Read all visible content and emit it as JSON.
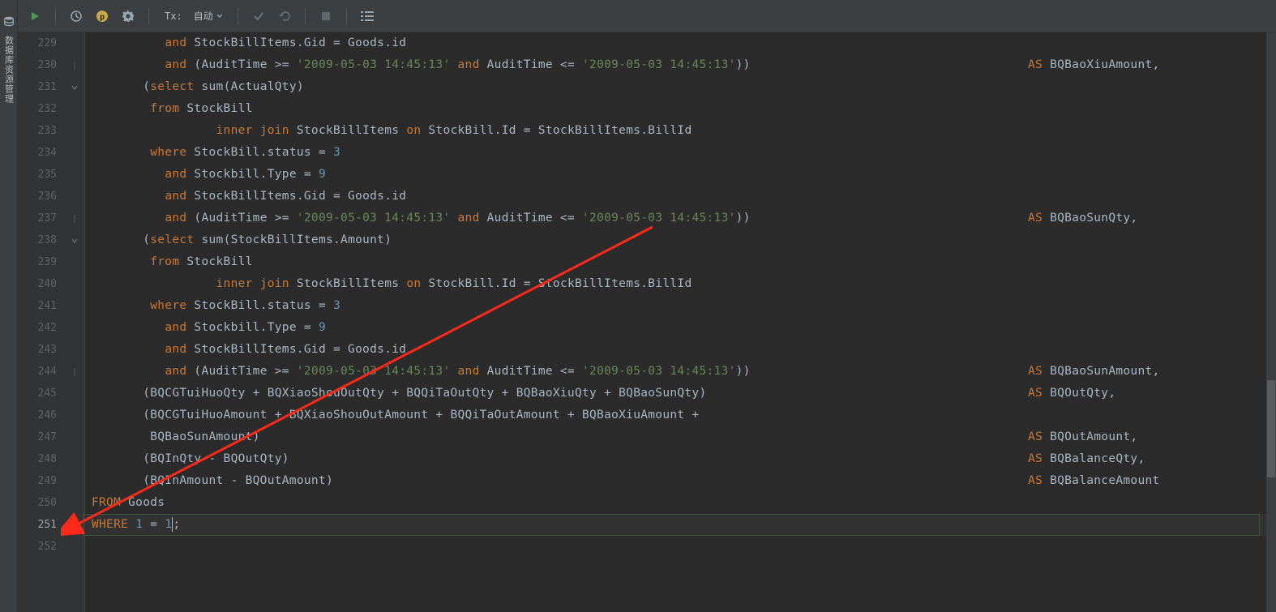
{
  "sidebar": {
    "label": "数据库资源管理"
  },
  "toolbar": {
    "tx_label": "Tx:",
    "tx_value": "自动"
  },
  "gutter": {
    "start": 229,
    "end": 252
  },
  "code": {
    "lines": [
      {
        "n": 229,
        "seg": [
          {
            "t": "          ",
            "c": ""
          },
          {
            "t": "and",
            "c": "kw"
          },
          {
            "t": " StockBillItems.Gid = Goods.id",
            "c": "id"
          }
        ]
      },
      {
        "n": 230,
        "fold": "mid",
        "seg": [
          {
            "t": "          ",
            "c": ""
          },
          {
            "t": "and",
            "c": "kw"
          },
          {
            "t": " (AuditTime >= ",
            "c": "id"
          },
          {
            "t": "'2009-05-03 14:45:13'",
            "c": "str"
          },
          {
            "t": " ",
            "c": ""
          },
          {
            "t": "and",
            "c": "kw"
          },
          {
            "t": " AuditTime <= ",
            "c": "id"
          },
          {
            "t": "'2009-05-03 14:45:13'",
            "c": "str"
          },
          {
            "t": "))",
            "c": "paren"
          }
        ],
        "right": [
          {
            "t": "AS",
            "c": "kw"
          },
          {
            "t": " BQBaoXiuAmount,",
            "c": "id"
          }
        ]
      },
      {
        "n": 231,
        "fold": "open",
        "seg": [
          {
            "t": "       (",
            "c": "paren"
          },
          {
            "t": "select",
            "c": "kw"
          },
          {
            "t": " ",
            "c": ""
          },
          {
            "t": "sum",
            "c": "fn"
          },
          {
            "t": "(ActualQty)",
            "c": "id"
          }
        ]
      },
      {
        "n": 232,
        "seg": [
          {
            "t": "        ",
            "c": ""
          },
          {
            "t": "from",
            "c": "kw"
          },
          {
            "t": " StockBill",
            "c": "id"
          }
        ]
      },
      {
        "n": 233,
        "seg": [
          {
            "t": "                 ",
            "c": ""
          },
          {
            "t": "inner join",
            "c": "kw"
          },
          {
            "t": " StockBillItems ",
            "c": "id"
          },
          {
            "t": "on",
            "c": "kw"
          },
          {
            "t": " StockBill.Id = StockBillItems.BillId",
            "c": "id"
          }
        ]
      },
      {
        "n": 234,
        "seg": [
          {
            "t": "        ",
            "c": ""
          },
          {
            "t": "where",
            "c": "kw"
          },
          {
            "t": " StockBill.status = ",
            "c": "id"
          },
          {
            "t": "3",
            "c": "num"
          }
        ]
      },
      {
        "n": 235,
        "seg": [
          {
            "t": "          ",
            "c": ""
          },
          {
            "t": "and",
            "c": "kw"
          },
          {
            "t": " Stockbill.Type = ",
            "c": "id"
          },
          {
            "t": "9",
            "c": "num"
          }
        ]
      },
      {
        "n": 236,
        "seg": [
          {
            "t": "          ",
            "c": ""
          },
          {
            "t": "and",
            "c": "kw"
          },
          {
            "t": " StockBillItems.Gid = Goods.id",
            "c": "id"
          }
        ]
      },
      {
        "n": 237,
        "fold": "mid",
        "seg": [
          {
            "t": "          ",
            "c": ""
          },
          {
            "t": "and",
            "c": "kw"
          },
          {
            "t": " (AuditTime >= ",
            "c": "id"
          },
          {
            "t": "'2009-05-03 14:45:13'",
            "c": "str"
          },
          {
            "t": " ",
            "c": ""
          },
          {
            "t": "and",
            "c": "kw"
          },
          {
            "t": " AuditTime <= ",
            "c": "id"
          },
          {
            "t": "'2009-05-03 14:45:13'",
            "c": "str"
          },
          {
            "t": "))",
            "c": "paren"
          }
        ],
        "right": [
          {
            "t": "AS",
            "c": "kw"
          },
          {
            "t": " BQBaoSunQty,",
            "c": "id"
          }
        ]
      },
      {
        "n": 238,
        "fold": "open",
        "seg": [
          {
            "t": "       (",
            "c": "paren"
          },
          {
            "t": "select",
            "c": "kw"
          },
          {
            "t": " ",
            "c": ""
          },
          {
            "t": "sum",
            "c": "fn"
          },
          {
            "t": "(StockBillItems.Amount)",
            "c": "id"
          }
        ]
      },
      {
        "n": 239,
        "seg": [
          {
            "t": "        ",
            "c": ""
          },
          {
            "t": "from",
            "c": "kw"
          },
          {
            "t": " StockBill",
            "c": "id"
          }
        ]
      },
      {
        "n": 240,
        "seg": [
          {
            "t": "                 ",
            "c": ""
          },
          {
            "t": "inner join",
            "c": "kw"
          },
          {
            "t": " StockBillItems ",
            "c": "id"
          },
          {
            "t": "on",
            "c": "kw"
          },
          {
            "t": " StockBill.Id = StockBillItems.BillId",
            "c": "id"
          }
        ]
      },
      {
        "n": 241,
        "seg": [
          {
            "t": "        ",
            "c": ""
          },
          {
            "t": "where",
            "c": "kw"
          },
          {
            "t": " StockBill.status = ",
            "c": "id"
          },
          {
            "t": "3",
            "c": "num"
          }
        ]
      },
      {
        "n": 242,
        "seg": [
          {
            "t": "          ",
            "c": ""
          },
          {
            "t": "and",
            "c": "kw"
          },
          {
            "t": " Stockbill.Type = ",
            "c": "id"
          },
          {
            "t": "9",
            "c": "num"
          }
        ]
      },
      {
        "n": 243,
        "seg": [
          {
            "t": "          ",
            "c": ""
          },
          {
            "t": "and",
            "c": "kw"
          },
          {
            "t": " StockBillItems.Gid = Goods.id",
            "c": "id"
          }
        ]
      },
      {
        "n": 244,
        "fold": "mid",
        "seg": [
          {
            "t": "          ",
            "c": ""
          },
          {
            "t": "and",
            "c": "kw"
          },
          {
            "t": " (AuditTime >= ",
            "c": "id"
          },
          {
            "t": "'2009-05-03 14:45:13'",
            "c": "str"
          },
          {
            "t": " ",
            "c": ""
          },
          {
            "t": "and",
            "c": "kw"
          },
          {
            "t": " AuditTime <= ",
            "c": "id"
          },
          {
            "t": "'2009-05-03 14:45:13'",
            "c": "str"
          },
          {
            "t": "))",
            "c": "paren"
          }
        ],
        "right": [
          {
            "t": "AS",
            "c": "kw"
          },
          {
            "t": " BQBaoSunAmount,",
            "c": "id"
          }
        ]
      },
      {
        "n": 245,
        "seg": [
          {
            "t": "       (BQCGTuiHuoQty + BQXiaoShouOutQty + BQQiTaOutQty + BQBaoXiuQty + BQBaoSunQty)",
            "c": "id"
          }
        ],
        "right": [
          {
            "t": "AS",
            "c": "kw"
          },
          {
            "t": " BQOutQty,",
            "c": "id"
          }
        ]
      },
      {
        "n": 246,
        "seg": [
          {
            "t": "       (BQCGTuiHuoAmount + BQXiaoShouOutAmount + BQQiTaOutAmount + BQBaoXiuAmount +",
            "c": "id"
          }
        ]
      },
      {
        "n": 247,
        "seg": [
          {
            "t": "        BQBaoSunAmount)",
            "c": "id"
          }
        ],
        "right": [
          {
            "t": "AS",
            "c": "kw"
          },
          {
            "t": " BQOutAmount,",
            "c": "id"
          }
        ]
      },
      {
        "n": 248,
        "seg": [
          {
            "t": "       (BQInQty - BQOutQty)",
            "c": "id"
          }
        ],
        "right": [
          {
            "t": "AS",
            "c": "kw"
          },
          {
            "t": " BQBalanceQty,",
            "c": "id"
          }
        ]
      },
      {
        "n": 249,
        "seg": [
          {
            "t": "       (BQInAmount - BQOutAmount)",
            "c": "id"
          }
        ],
        "right": [
          {
            "t": "AS",
            "c": "kw"
          },
          {
            "t": " BQBalanceAmount",
            "c": "id"
          }
        ]
      },
      {
        "n": 250,
        "seg": [
          {
            "t": "FROM",
            "c": "kw"
          },
          {
            "t": " Goods",
            "c": "id"
          }
        ]
      },
      {
        "n": 251,
        "active": true,
        "seg": [
          {
            "t": "WHERE",
            "c": "kw"
          },
          {
            "t": " ",
            "c": ""
          },
          {
            "t": "1",
            "c": "num"
          },
          {
            "t": " = ",
            "c": "op"
          },
          {
            "t": "1",
            "c": "num"
          },
          {
            "t": ";",
            "c": "punct"
          }
        ],
        "cursor_after": 4
      },
      {
        "n": 252,
        "seg": []
      }
    ]
  }
}
